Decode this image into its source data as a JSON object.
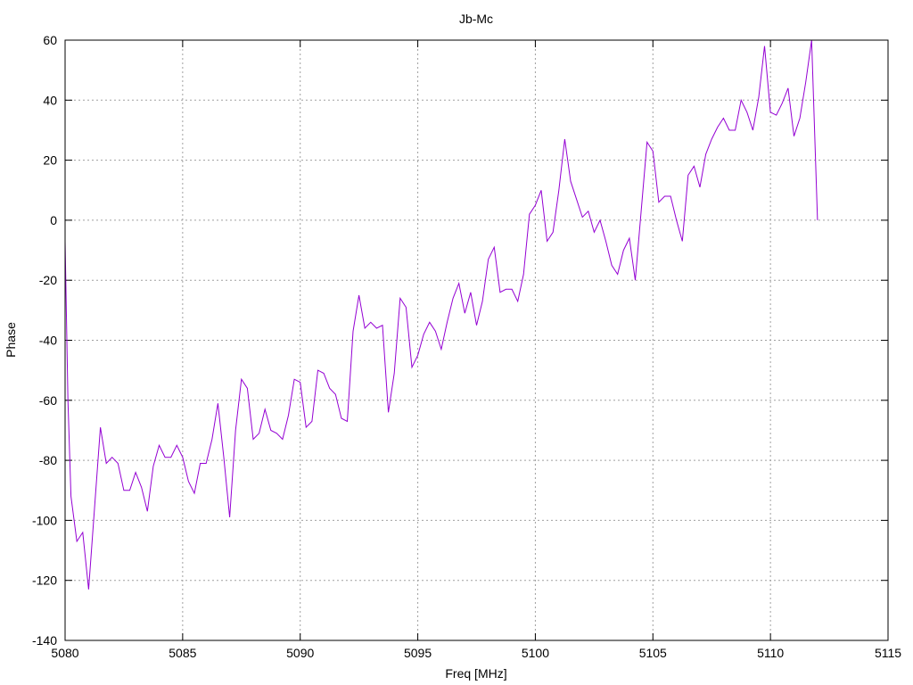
{
  "chart_data": {
    "type": "line",
    "title": "Jb-Mc",
    "xlabel": "Freq [MHz]",
    "ylabel": "Phase",
    "xlim": [
      5080,
      5115
    ],
    "ylim": [
      -140,
      60
    ],
    "xticks": [
      5080,
      5085,
      5090,
      5095,
      5100,
      5105,
      5110,
      5115
    ],
    "yticks": [
      -140,
      -120,
      -100,
      -80,
      -60,
      -40,
      -20,
      0,
      20,
      40,
      60
    ],
    "grid": true,
    "line_color": "#9400d3",
    "series": [
      {
        "x": [
          5080.0,
          5080.12,
          5080.25,
          5080.5,
          5080.75,
          5081.0,
          5081.25,
          5081.5,
          5081.75,
          5082.0,
          5082.25,
          5082.5,
          5082.75,
          5083.0,
          5083.25,
          5083.5,
          5083.75,
          5084.0,
          5084.25,
          5084.5,
          5084.75,
          5085.0,
          5085.25,
          5085.5,
          5085.75,
          5086.0,
          5086.25,
          5086.5,
          5086.75,
          5087.0,
          5087.25,
          5087.5,
          5087.75,
          5088.0,
          5088.25,
          5088.5,
          5088.75,
          5089.0,
          5089.25,
          5089.5,
          5089.75,
          5090.0,
          5090.25,
          5090.5,
          5090.75,
          5091.0,
          5091.25,
          5091.5,
          5091.75,
          5092.0,
          5092.25,
          5092.5,
          5092.75,
          5093.0,
          5093.25,
          5093.5,
          5093.75,
          5094.0,
          5094.25,
          5094.5,
          5094.75,
          5095.0,
          5095.25,
          5095.5,
          5095.75,
          5096.0,
          5096.25,
          5096.5,
          5096.75,
          5097.0,
          5097.25,
          5097.5,
          5097.75,
          5098.0,
          5098.25,
          5098.5,
          5098.75,
          5099.0,
          5099.25,
          5099.5,
          5099.75,
          5100.0,
          5100.25,
          5100.5,
          5100.75,
          5101.0,
          5101.25,
          5101.5,
          5101.75,
          5102.0,
          5102.25,
          5102.5,
          5102.75,
          5103.0,
          5103.25,
          5103.5,
          5103.75,
          5104.0,
          5104.25,
          5104.5,
          5104.75,
          5105.0,
          5105.25,
          5105.5,
          5105.75,
          5106.0,
          5106.25,
          5106.5,
          5106.75,
          5107.0,
          5107.25,
          5107.5,
          5107.75,
          5108.0,
          5108.25,
          5108.5,
          5108.75,
          5109.0,
          5109.25,
          5109.5,
          5109.75,
          5110.0,
          5110.25,
          5110.5,
          5110.75,
          5111.0,
          5111.25,
          5111.5,
          5111.75,
          5112.0
        ],
        "y": [
          -7,
          -60,
          -92,
          -107,
          -104,
          -123,
          -96,
          -69,
          -81,
          -79,
          -81,
          -90,
          -90,
          -84,
          -89,
          -97,
          -82,
          -75,
          -79,
          -79,
          -75,
          -79,
          -87,
          -91,
          -81,
          -81,
          -73,
          -61,
          -79,
          -99,
          -70,
          -53,
          -56,
          -73,
          -71,
          -63,
          -70,
          -71,
          -73,
          -65,
          -53,
          -54,
          -69,
          -67,
          -50,
          -51,
          -56,
          -58,
          -66,
          -67,
          -37,
          -25,
          -36,
          -34,
          -36,
          -35,
          -64,
          -51,
          -26,
          -29,
          -49,
          -45,
          -38,
          -34,
          -37,
          -43,
          -34,
          -26,
          -21,
          -31,
          -24,
          -35,
          -27,
          -13,
          -9,
          -24,
          -23,
          -23,
          -27,
          -18,
          2,
          5,
          10,
          -7,
          -4,
          10,
          27,
          13,
          7,
          1,
          3,
          -4,
          0,
          -7,
          -15,
          -18,
          -10,
          -6,
          -20,
          3,
          26,
          23,
          6,
          8,
          8,
          0,
          -7,
          15,
          18,
          11,
          22,
          27,
          31,
          34,
          30,
          30,
          40,
          36,
          30,
          41,
          58,
          36,
          35,
          39,
          44,
          28,
          34,
          46,
          60,
          0
        ]
      }
    ]
  }
}
